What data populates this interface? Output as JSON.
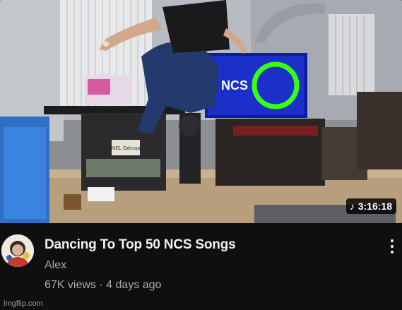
{
  "video": {
    "duration": "3:16:18",
    "duration_icon": "music-note-icon",
    "title": "Dancing To Top 50 NCS Songs",
    "channel": "Alex",
    "views": "67K views",
    "separator": "·",
    "age": "4 days ago"
  },
  "thumbnail": {
    "tv_text": "NCS",
    "book_text": "MEL Odessa"
  },
  "menu": {
    "icon": "more-vertical-icon"
  },
  "watermark": "imgflip.com",
  "colors": {
    "background": "#0f0f0f",
    "title": "#f1f1f1",
    "secondary": "#aaaaaa",
    "ncs_ring": "#39ff14"
  }
}
